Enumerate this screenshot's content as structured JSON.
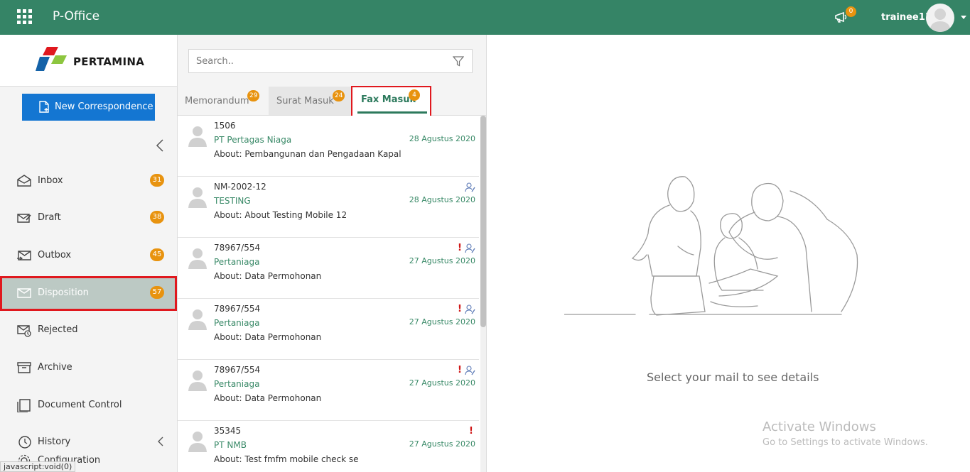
{
  "header": {
    "app_title": "P-Office",
    "notification_count": "0",
    "username": "trainee11"
  },
  "sidebar": {
    "logo_text": "PERTAMINA",
    "new_button_label": "New Correspondence",
    "items": [
      {
        "label": "Inbox",
        "badge": "31",
        "icon": "inbox-icon"
      },
      {
        "label": "Draft",
        "badge": "38",
        "icon": "draft-icon"
      },
      {
        "label": "Outbox",
        "badge": "45",
        "icon": "outbox-icon"
      },
      {
        "label": "Disposition",
        "badge": "57",
        "icon": "disposition-icon",
        "active": true
      },
      {
        "label": "Rejected",
        "icon": "rejected-icon"
      },
      {
        "label": "Archive",
        "icon": "archive-icon"
      },
      {
        "label": "Document Control",
        "icon": "document-control-icon"
      },
      {
        "label": "History",
        "icon": "history-icon"
      },
      {
        "label": "Configuration",
        "icon": "gear-icon"
      }
    ],
    "status_url": "javascript:void(0)"
  },
  "list": {
    "search_placeholder": "Search..",
    "tabs": [
      {
        "label": "Memorandum",
        "badge": "29"
      },
      {
        "label": "Surat Masuk",
        "badge": "24"
      },
      {
        "label": "Fax Masuk",
        "badge": "4",
        "active": true
      }
    ],
    "rows": [
      {
        "number": "1506",
        "sender": "PT Pertagas Niaga",
        "date": "28 Agustus 2020",
        "about": "About: Pembangunan dan Pengadaan Kapal",
        "urgent": false,
        "disposition": false
      },
      {
        "number": "NM-2002-12",
        "sender": "TESTING",
        "date": "28 Agustus 2020",
        "about": "About: About Testing Mobile 12",
        "urgent": false,
        "disposition": true
      },
      {
        "number": "78967/554",
        "sender": "Pertaniaga",
        "date": "27 Agustus 2020",
        "about": "About: Data Permohonan",
        "urgent": true,
        "disposition": true
      },
      {
        "number": "78967/554",
        "sender": "Pertaniaga",
        "date": "27 Agustus 2020",
        "about": "About: Data Permohonan",
        "urgent": true,
        "disposition": true
      },
      {
        "number": "78967/554",
        "sender": "Pertaniaga",
        "date": "27 Agustus 2020",
        "about": "About: Data Permohonan",
        "urgent": true,
        "disposition": true
      },
      {
        "number": "35345",
        "sender": "PT NMB",
        "date": "27 Agustus 2020",
        "about": "About: Test fmfm mobile check se",
        "urgent": true,
        "disposition": false
      }
    ],
    "urgent_mark": "!"
  },
  "detail": {
    "empty_message": "Select your mail to see details",
    "watermark_title": "Activate Windows",
    "watermark_sub": "Go to Settings to activate Windows."
  },
  "colors": {
    "header": "#358466",
    "badge": "#e8930f",
    "primary_button": "#1476d2",
    "highlight_outline": "#e0181e",
    "accent_text": "#3a8a68"
  }
}
